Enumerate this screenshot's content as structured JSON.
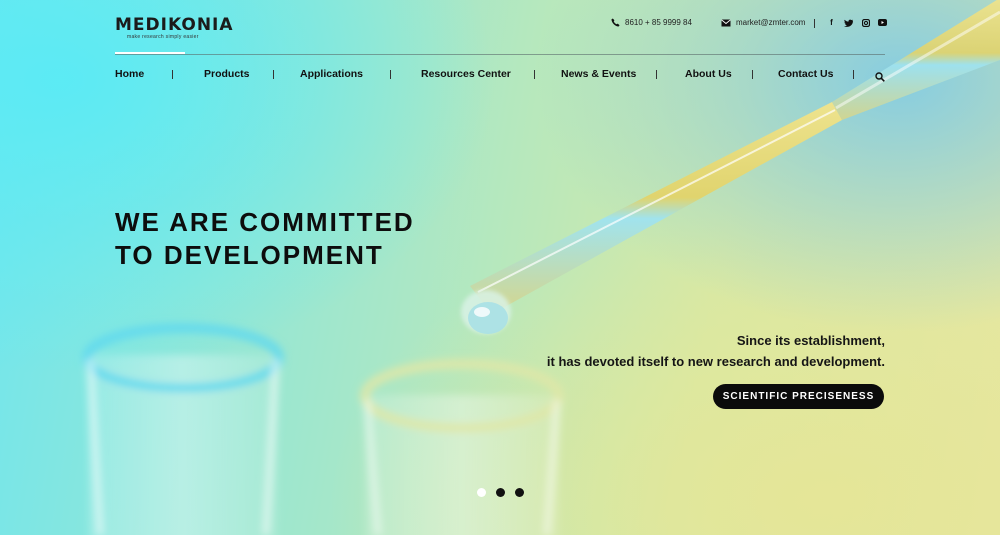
{
  "brand": {
    "name": "MEDIKONIA",
    "tagline": "make research simply easier"
  },
  "contact": {
    "phone": "8610 + 85 9999 84",
    "email": "market@zmter.com"
  },
  "social": [
    {
      "icon": "facebook-icon",
      "glyph": "f"
    },
    {
      "icon": "twitter-icon",
      "glyph": "t"
    },
    {
      "icon": "instagram-icon",
      "glyph": "◎"
    },
    {
      "icon": "youtube-icon",
      "glyph": "▶"
    }
  ],
  "nav": {
    "items": [
      "Home",
      "Products",
      "Applications",
      "Resources Center",
      "News & Events",
      "About Us",
      "Contact Us"
    ],
    "search_icon": "search-icon"
  },
  "hero": {
    "headline_line1": "WE ARE COMMITTED",
    "headline_line2": "TO DEVELOPMENT",
    "sub_line1": "Since its establishment,",
    "sub_line2": "it has devoted itself to new research and development.",
    "cta_label": "SCIENTIFIC PRECISENESS"
  },
  "carousel": {
    "slides": 3,
    "active_index": 0
  },
  "colors": {
    "accent": "#0b0b0b",
    "text": "#111111",
    "bg_cyan": "#6fe6ee",
    "bg_yellow": "#e6e7a2"
  }
}
